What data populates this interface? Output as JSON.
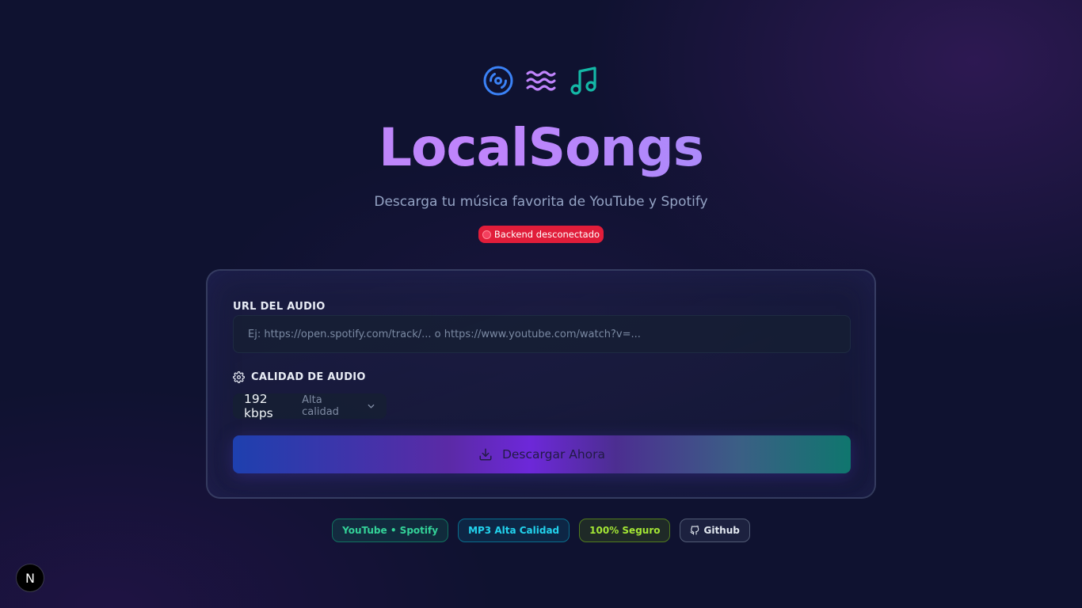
{
  "hero": {
    "icons": [
      "disc-icon",
      "waves-icon",
      "music-note-icon"
    ],
    "title": "LocalSongs",
    "subtitle": "Descarga tu música favorita de YouTube y Spotify"
  },
  "status": {
    "text": "Backend desconectado",
    "icon": "red-circle-icon",
    "color": "#e11d3a"
  },
  "form": {
    "url_label": "URL DEL AUDIO",
    "url_value": "",
    "url_placeholder": "Ej: https://open.spotify.com/track/... o https://www.youtube.com/watch?v=...",
    "quality_label": "CALIDAD DE AUDIO",
    "quality_icon": "gear-icon",
    "quality_value": "192 kbps",
    "quality_desc": "Alta calidad",
    "download_label": "Descargar Ahora",
    "download_icon": "download-icon"
  },
  "chips": [
    {
      "label": "YouTube • Spotify",
      "color": "#34d399"
    },
    {
      "label": "MP3 Alta Calidad",
      "color": "#22d3ee"
    },
    {
      "label": "100% Seguro",
      "color": "#a3e635"
    },
    {
      "label": "Github",
      "icon": "github-icon",
      "color": "#e2e8f0"
    }
  ],
  "dev_badge": {
    "label": "N"
  },
  "colors": {
    "background": "#0f1230",
    "title_gradient_start": "#b48cf5",
    "title_gradient_end": "#9fb2f2",
    "disc_icon": "#3b82f6",
    "waves_icon": "#c084fc",
    "music_icon": "#14b8a6"
  }
}
